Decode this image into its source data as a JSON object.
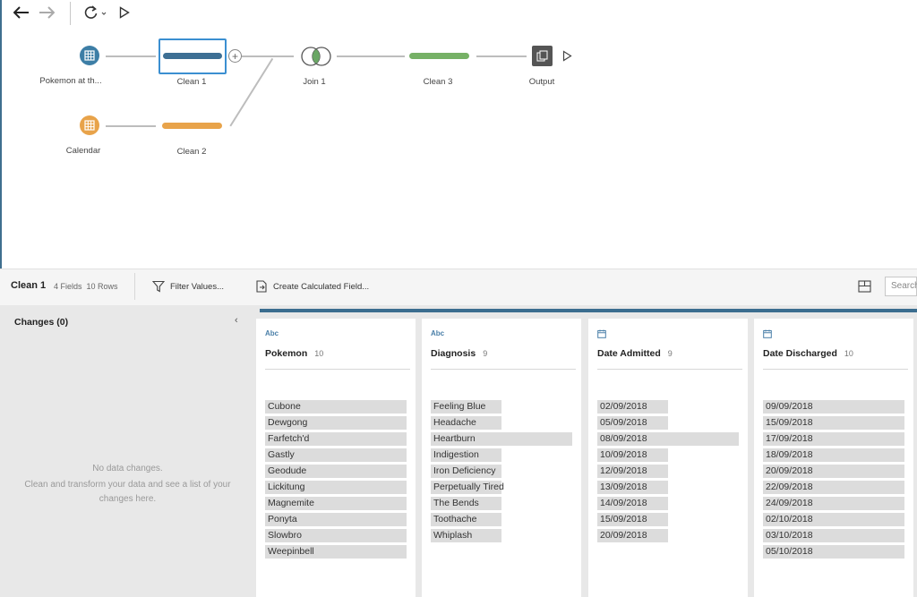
{
  "toolbar": {
    "back_icon": "arrow-left-icon",
    "forward_icon": "arrow-right-icon",
    "refresh_icon": "refresh-icon",
    "run_icon": "play-icon"
  },
  "flow": {
    "nodes": [
      {
        "label": "Pokemon at th...",
        "icon": "table-icon",
        "color": "#3d7ea6"
      },
      {
        "label": "Clean 1",
        "icon": "clean-step",
        "color": "#3d6f94"
      },
      {
        "label": "Calendar",
        "icon": "table-icon",
        "color": "#e8a34a"
      },
      {
        "label": "Clean 2",
        "icon": "clean-step",
        "color": "#e8a34a"
      },
      {
        "label": "Join 1",
        "icon": "join-icon",
        "color": "#6aa765"
      },
      {
        "label": "Clean 3",
        "icon": "clean-step",
        "color": "#76b166"
      },
      {
        "label": "Output",
        "icon": "output-icon",
        "color": "#555555"
      }
    ],
    "add_step_icon": "plus-circle-icon"
  },
  "panel": {
    "title": "Clean 1",
    "meta": "4 Fields  10 Rows",
    "filter_label": "Filter Values...",
    "calc_label": "Create Calculated Field...",
    "search_placeholder": "Search"
  },
  "changes": {
    "title": "Changes (0)",
    "empty_title": "No data changes.",
    "empty_body": "Clean and transform your data and see a list of your changes here."
  },
  "fields": [
    {
      "type": "Abc",
      "name": "Pokemon",
      "count": "10",
      "values": [
        "Cubone",
        "Dewgong",
        "Farfetch'd",
        "Gastly",
        "Geodude",
        "Lickitung",
        "Magnemite",
        "Ponyta",
        "Slowbro",
        "Weepinbell"
      ],
      "bar_fracs": [
        1,
        1,
        1,
        1,
        1,
        1,
        1,
        1,
        1,
        1
      ]
    },
    {
      "type": "Abc",
      "name": "Diagnosis",
      "count": "9",
      "values": [
        "Feeling Blue",
        "Headache",
        "Heartburn",
        "Indigestion",
        "Iron Deficiency",
        "Perpetually Tired",
        "The Bends",
        "Toothache",
        "Whiplash"
      ],
      "bar_fracs": [
        0.5,
        0.5,
        1,
        0.5,
        0.5,
        0.5,
        0.5,
        0.5,
        0.5
      ]
    },
    {
      "type": "date-icon",
      "name": "Date Admitted",
      "count": "9",
      "values": [
        "02/09/2018",
        "05/09/2018",
        "08/09/2018",
        "10/09/2018",
        "12/09/2018",
        "13/09/2018",
        "14/09/2018",
        "15/09/2018",
        "20/09/2018"
      ],
      "bar_fracs": [
        0.5,
        0.5,
        1,
        0.5,
        0.5,
        0.5,
        0.5,
        0.5,
        0.5
      ]
    },
    {
      "type": "date-icon",
      "name": "Date Discharged",
      "count": "10",
      "values": [
        "09/09/2018",
        "15/09/2018",
        "17/09/2018",
        "18/09/2018",
        "20/09/2018",
        "22/09/2018",
        "24/09/2018",
        "02/10/2018",
        "03/10/2018",
        "05/10/2018"
      ],
      "bar_fracs": [
        1,
        1,
        1,
        1,
        1,
        1,
        1,
        1,
        1,
        1
      ]
    }
  ]
}
